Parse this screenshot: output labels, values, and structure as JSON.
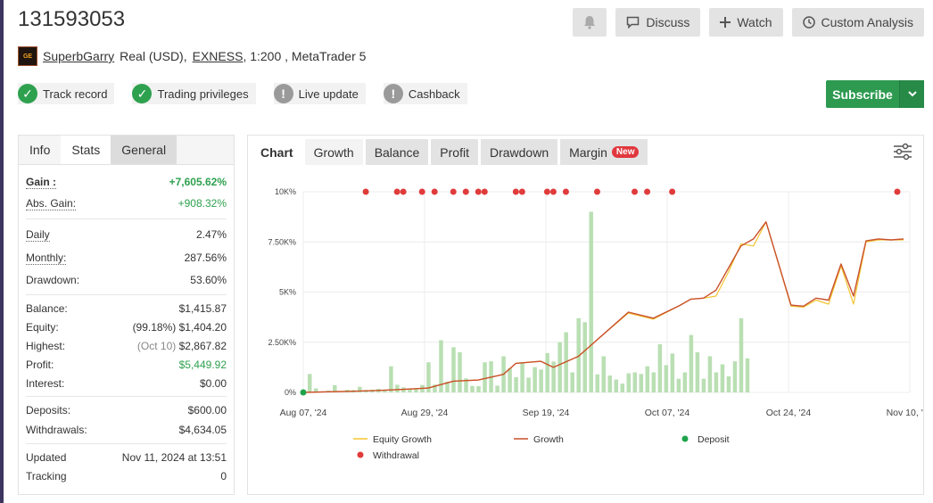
{
  "account": {
    "number": "131593053",
    "owner": "SuperbGarry",
    "type_text": "Real (USD),",
    "broker": "EXNESS",
    "details": ", 1:200 , MetaTrader 5",
    "avatar_text": "GE"
  },
  "top_actions": {
    "discuss": "Discuss",
    "watch": "Watch",
    "custom_analysis": "Custom Analysis"
  },
  "badges": [
    {
      "label": "Track record",
      "status": "ok"
    },
    {
      "label": "Trading privileges",
      "status": "ok"
    },
    {
      "label": "Live update",
      "status": "na"
    },
    {
      "label": "Cashback",
      "status": "na"
    }
  ],
  "subscribe": {
    "label": "Subscribe"
  },
  "stats_tabs": [
    "Info",
    "Stats",
    "General"
  ],
  "stats": {
    "gain_label": "Gain :",
    "gain": "+7,605.62%",
    "abs_gain_label": "Abs. Gain:",
    "abs_gain": "+908.32%",
    "daily_label": "Daily",
    "daily": "2.47%",
    "monthly_label": "Monthly:",
    "monthly": "287.56%",
    "drawdown_label": "Drawdown:",
    "drawdown": "53.60%",
    "balance_label": "Balance:",
    "balance": "$1,415.87",
    "equity_label": "Equity:",
    "equity_pct": "(99.18%)",
    "equity": "$1,404.20",
    "highest_label": "Highest:",
    "highest_date": "(Oct 10)",
    "highest": "$2,867.82",
    "profit_label": "Profit:",
    "profit": "$5,449.92",
    "interest_label": "Interest:",
    "interest": "$0.00",
    "deposits_label": "Deposits:",
    "deposits": "$600.00",
    "withdrawals_label": "Withdrawals:",
    "withdrawals": "$4,634.05",
    "updated_label": "Updated",
    "updated": "Nov 11, 2024 at 13:51",
    "tracking_label": "Tracking",
    "tracking": "0"
  },
  "chart_tabs": {
    "label": "Chart",
    "items": [
      "Growth",
      "Balance",
      "Profit",
      "Drawdown",
      "Margin"
    ],
    "active": "Growth",
    "new_badge": "New"
  },
  "colors": {
    "equity": "#f2c530",
    "growth": "#c9502c",
    "deposit": "#1fa34a",
    "withdrawal": "#e03b3b",
    "bars": "#b9dfb3"
  },
  "chart_data": {
    "type": "line",
    "x_ticks": [
      "Aug 07, '24",
      "Aug 29, '24",
      "Sep 19, '24",
      "Oct 07, '24",
      "Oct 24, '24",
      "Nov 10, '24"
    ],
    "y_ticks": [
      "0%",
      "2.50K%",
      "5K%",
      "7.50K%",
      "10K%"
    ],
    "ylim": [
      0,
      10000
    ],
    "legend": [
      "Equity Growth",
      "Growth",
      "Deposit",
      "Withdrawal"
    ],
    "grid": true,
    "series": [
      {
        "name": "Growth",
        "x": [
          0,
          4,
          8,
          12,
          16,
          20,
          24,
          28,
          32,
          34,
          38,
          40,
          44,
          48,
          52,
          56,
          60,
          62,
          64,
          66,
          68,
          70,
          72,
          74,
          78,
          80,
          82,
          84,
          86,
          88,
          90,
          92,
          94,
          96
        ],
        "values": [
          0,
          30,
          60,
          100,
          150,
          220,
          560,
          620,
          900,
          1450,
          1550,
          1250,
          1800,
          2900,
          4000,
          3700,
          4300,
          4650,
          4700,
          5100,
          6200,
          7300,
          7650,
          8500,
          4350,
          4300,
          4700,
          4600,
          6400,
          4800,
          7550,
          7650,
          7600,
          7650
        ]
      },
      {
        "name": "Equity Growth",
        "x": [
          0,
          4,
          8,
          12,
          16,
          20,
          24,
          28,
          32,
          34,
          38,
          40,
          44,
          48,
          52,
          56,
          60,
          62,
          64,
          66,
          68,
          70,
          72,
          74,
          78,
          80,
          82,
          84,
          86,
          88,
          90,
          92,
          94,
          96
        ],
        "values": [
          0,
          30,
          60,
          100,
          150,
          220,
          560,
          620,
          900,
          1450,
          1550,
          1250,
          1800,
          2900,
          3950,
          3650,
          4300,
          4650,
          4700,
          4800,
          6000,
          7400,
          7300,
          8500,
          4300,
          4250,
          4600,
          4400,
          6300,
          4400,
          7500,
          7600,
          7600,
          7600
        ]
      }
    ],
    "x_range": [
      0,
      97
    ],
    "bars": {
      "x": [
        1,
        2,
        4,
        5,
        7,
        8,
        9,
        10,
        11,
        12,
        13,
        14,
        15,
        16,
        17,
        18,
        19,
        20,
        21,
        22,
        23,
        24,
        25,
        26,
        27,
        28,
        29,
        30,
        31,
        32,
        33,
        34,
        35,
        36,
        37,
        38,
        39,
        40,
        41,
        42,
        43,
        44,
        45,
        46,
        47,
        48,
        49,
        50,
        51,
        52,
        53,
        54,
        55,
        56,
        57,
        58,
        59,
        60,
        61,
        62,
        63,
        64,
        65,
        66,
        67,
        68,
        69,
        70,
        71,
        72,
        73,
        74,
        75,
        76,
        77,
        78,
        79,
        80,
        81,
        82,
        83,
        84,
        85,
        86,
        87,
        88,
        89,
        90,
        91,
        92,
        93,
        94,
        95,
        96
      ],
      "values": [
        920,
        200,
        90,
        360,
        130,
        120,
        280,
        120,
        130,
        180,
        110,
        1300,
        380,
        250,
        180,
        200,
        370,
        1500,
        390,
        2600,
        540,
        2250,
        2000,
        700,
        320,
        310,
        1500,
        1550,
        340,
        1800,
        1200,
        760,
        1500,
        740,
        1260,
        1140,
        1960,
        1540,
        2500,
        3000,
        1000,
        3700,
        3500,
        9000,
        900,
        1800,
        840,
        640,
        440,
        950,
        1000,
        920,
        1300,
        1000,
        2400,
        1360,
        1940,
        680,
        1000,
        2860,
        2000,
        680,
        1800,
        1000,
        1400,
        800,
        1550,
        3700,
        1700,
        0,
        0,
        0,
        0,
        0,
        0,
        0,
        0,
        0,
        0,
        0,
        0,
        0,
        0,
        0,
        0,
        0,
        0,
        0,
        0,
        0,
        0,
        0,
        0,
        0
      ]
    },
    "withdrawal_x": [
      10,
      15,
      16,
      19,
      21,
      24,
      26,
      28,
      29,
      34,
      35,
      39,
      40,
      42,
      47,
      53,
      55,
      59,
      95
    ],
    "deposit_x": [
      0
    ]
  }
}
